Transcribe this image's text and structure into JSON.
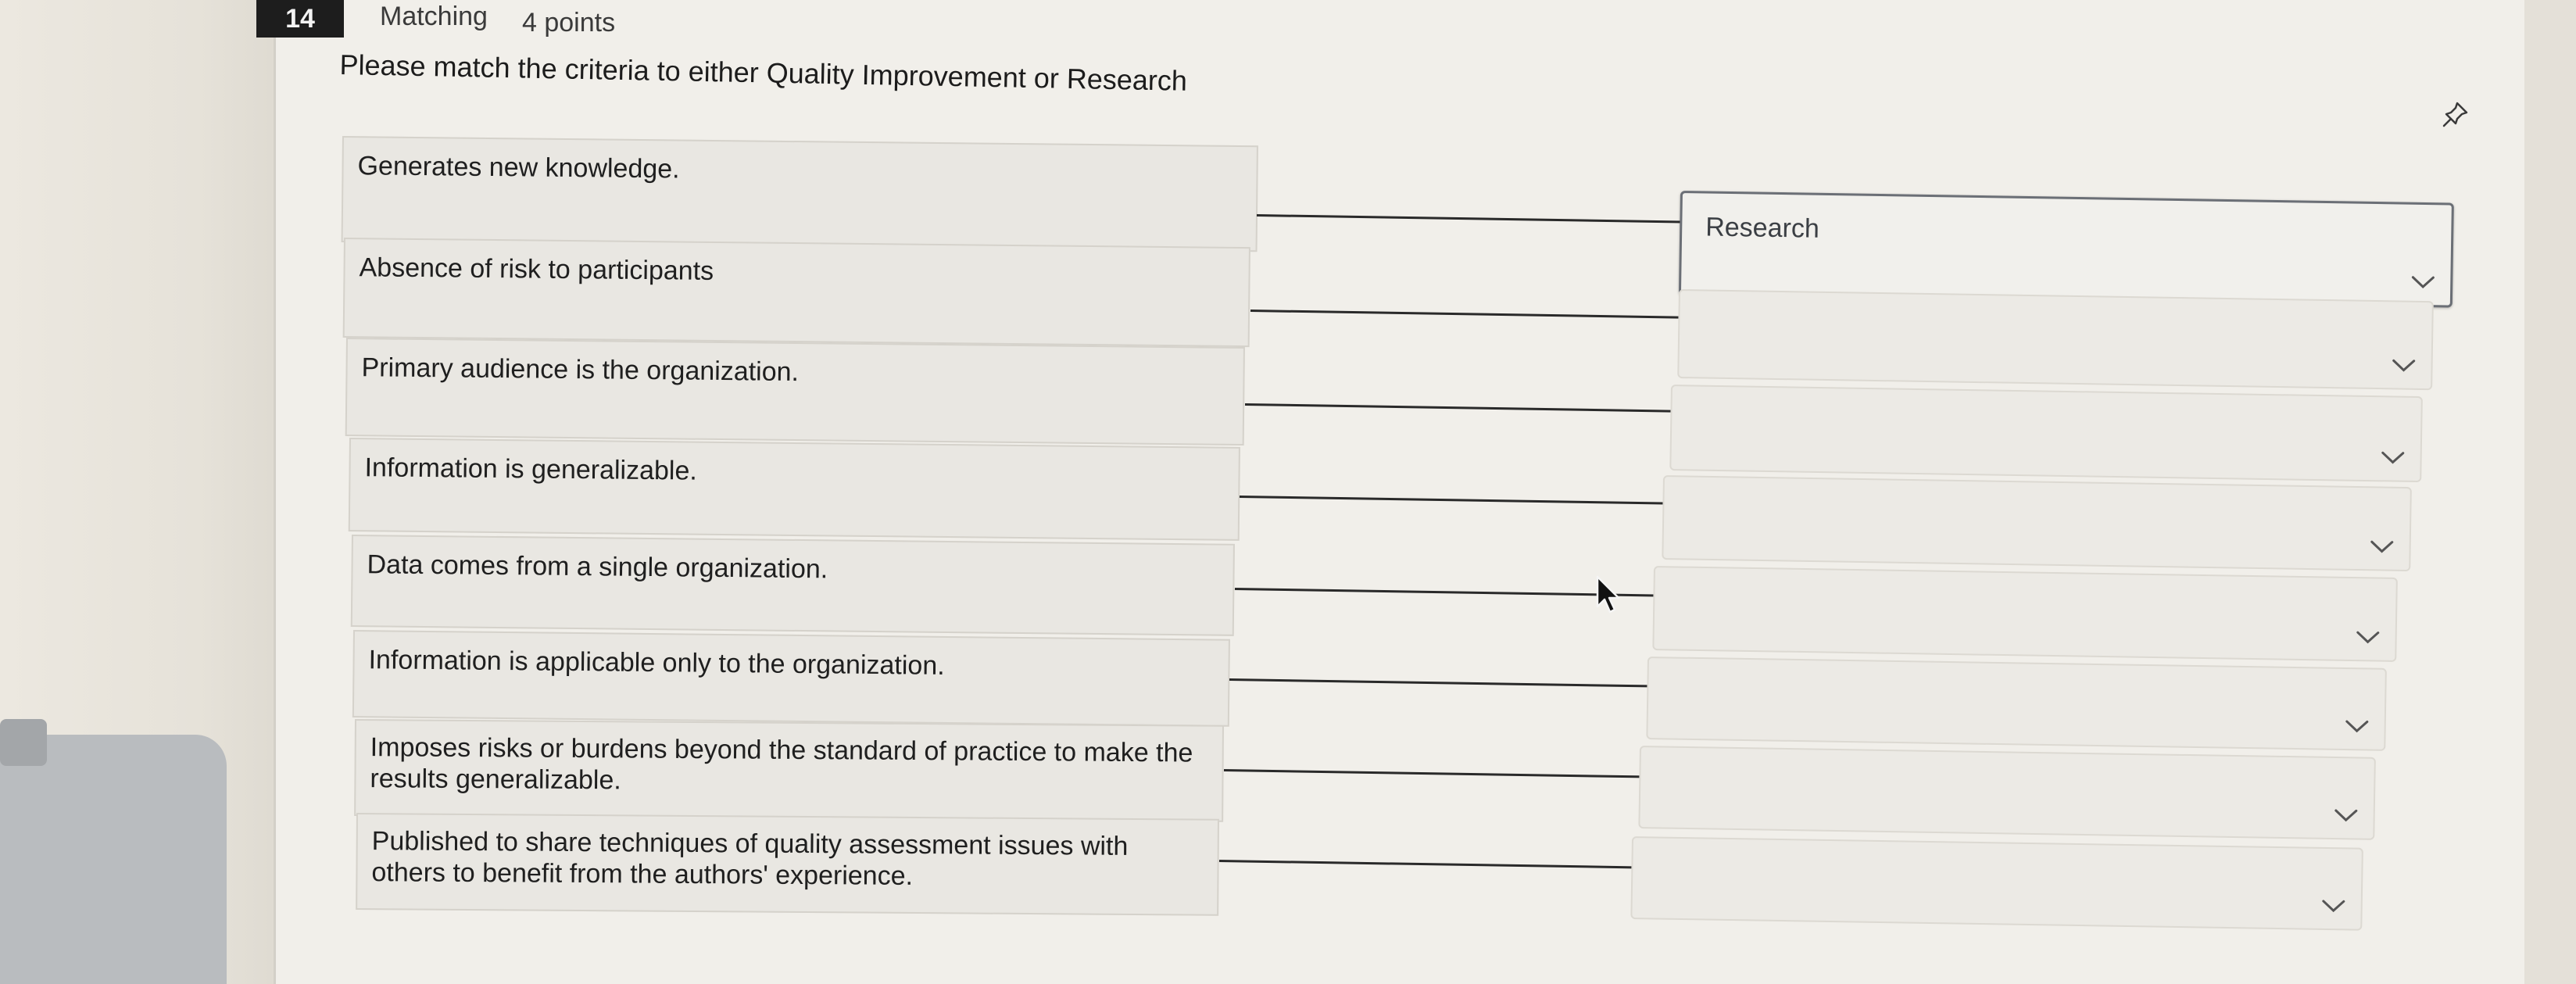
{
  "question": {
    "number": "14",
    "type": "Matching",
    "points": "4 points",
    "prompt": "Please match the criteria to either Quality Improvement or Research"
  },
  "items": [
    {
      "criterion": "Generates new knowledge.",
      "selected": "Research"
    },
    {
      "criterion": "Absence of risk to participants",
      "selected": ""
    },
    {
      "criterion": "Primary audience is the organization.",
      "selected": ""
    },
    {
      "criterion": "Information is generalizable.",
      "selected": ""
    },
    {
      "criterion": "Data comes from a single organization.",
      "selected": ""
    },
    {
      "criterion": "Information is applicable only to the organization.",
      "selected": ""
    },
    {
      "criterion": "Imposes risks or burdens beyond the standard of practice to make the results generalizable.",
      "selected": ""
    },
    {
      "criterion": "Published to share techniques of quality assessment issues with others to benefit from the authors' experience.",
      "selected": ""
    }
  ],
  "icons": {
    "pin": "pin-icon",
    "dropdown": "chevron-down-icon",
    "cursor": "mouse-pointer-icon"
  },
  "colors": {
    "question_badge": "#1d1d1d",
    "connector": "#2a2a2a",
    "active_select_border": "#6b6f76"
  }
}
